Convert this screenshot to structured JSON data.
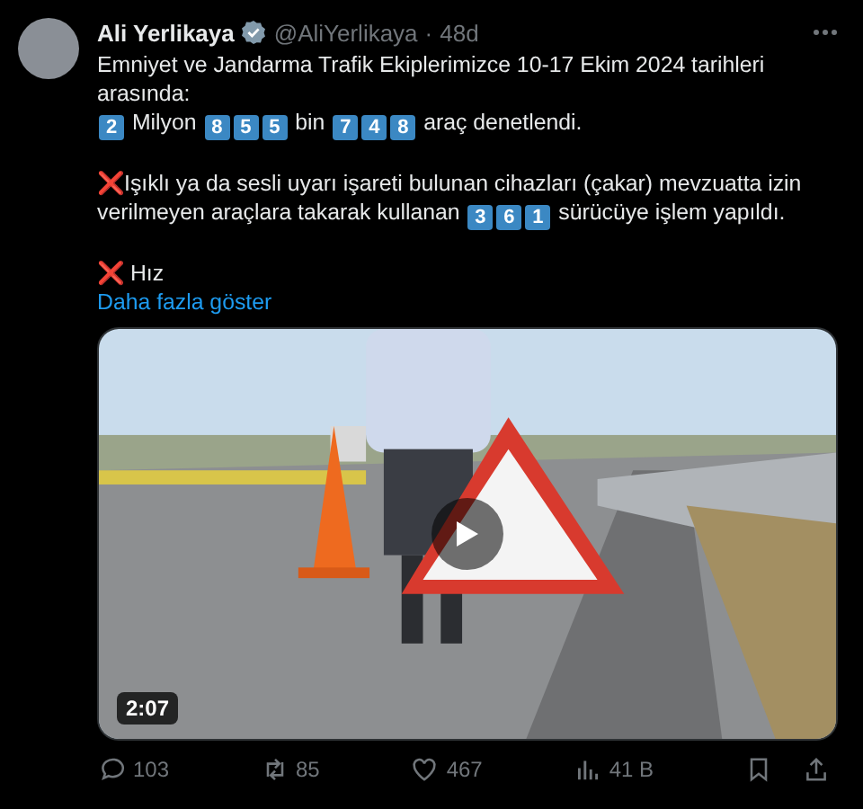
{
  "author": {
    "name": "Ali Yerlikaya",
    "verified": true,
    "handle": "@AliYerlikaya",
    "separator": "·",
    "time": "48d"
  },
  "body": [
    {
      "lines": [
        [
          {
            "kind": "text",
            "text": "Emniyet ve Jandarma Trafik Ekiplerimizce 10-17 Ekim 2024 tarihleri arasında:"
          }
        ],
        [
          {
            "kind": "key",
            "text": "2"
          },
          {
            "kind": "text",
            "text": " Milyon "
          },
          {
            "kind": "key",
            "text": "8"
          },
          {
            "kind": "key",
            "text": "5"
          },
          {
            "kind": "key",
            "text": "5"
          },
          {
            "kind": "text",
            "text": " bin "
          },
          {
            "kind": "key",
            "text": "7"
          },
          {
            "kind": "key",
            "text": "4"
          },
          {
            "kind": "key",
            "text": "8"
          },
          {
            "kind": "text",
            "text": " araç denetlendi."
          }
        ]
      ]
    },
    {
      "lines": [
        [
          {
            "kind": "emoji",
            "text": "❌"
          },
          {
            "kind": "text",
            "text": "Işıklı ya da sesli uyarı işareti bulunan cihazları (çakar) mevzuatta izin verilmeyen araçlara takarak kullanan "
          },
          {
            "kind": "key",
            "text": "3"
          },
          {
            "kind": "key",
            "text": "6"
          },
          {
            "kind": "key",
            "text": "1"
          },
          {
            "kind": "text",
            "text": "  sürücüye işlem yapıldı."
          }
        ]
      ]
    },
    {
      "lines": [
        [
          {
            "kind": "emoji",
            "text": "❌"
          },
          {
            "kind": "text",
            "text": " Hız"
          }
        ]
      ]
    }
  ],
  "show_more": "Daha fazla göster",
  "video": {
    "duration": "2:07"
  },
  "actions": [
    {
      "kind": "reply",
      "count": "103"
    },
    {
      "kind": "repost",
      "count": "85"
    },
    {
      "kind": "like",
      "count": "467"
    },
    {
      "kind": "views",
      "count": "41 B"
    },
    {
      "kind": "bookmark"
    },
    {
      "kind": "share"
    }
  ]
}
